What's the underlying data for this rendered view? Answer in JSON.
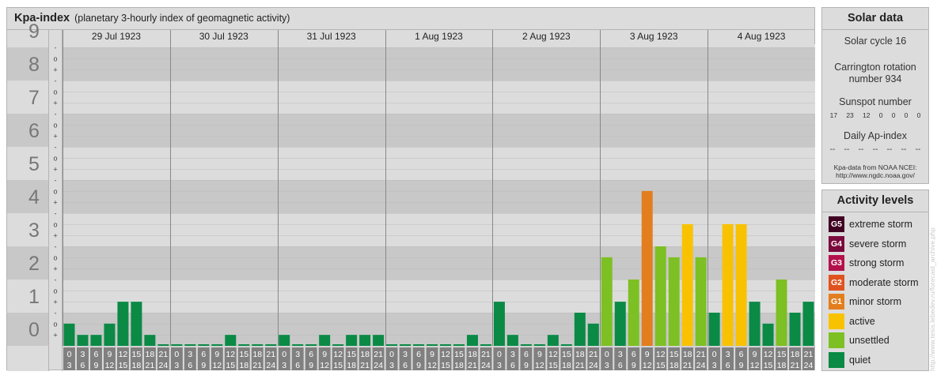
{
  "header": {
    "title": "Kpa-index",
    "subtitle": "(planetary 3-hourly index of geomagnetic activity)"
  },
  "chart_data": {
    "type": "bar",
    "ylim": [
      0,
      9
    ],
    "y_ticks": [
      "0",
      "1",
      "2",
      "3",
      "4",
      "5",
      "6",
      "7",
      "8",
      "9"
    ],
    "minor_tick_labels": [
      "+",
      "o",
      "-"
    ],
    "days": [
      "29 Jul 1923",
      "30 Jul 1923",
      "31 Jul 1923",
      "1 Aug 1923",
      "2 Aug 1923",
      "3 Aug 1923",
      "4 Aug 1923"
    ],
    "interval_starts": [
      "0",
      "3",
      "6",
      "9",
      "12",
      "15",
      "18",
      "21"
    ],
    "interval_ends": [
      "3",
      "6",
      "9",
      "12",
      "15",
      "18",
      "21",
      "24"
    ],
    "values": [
      0.67,
      0.33,
      0.33,
      0.67,
      1.33,
      1.33,
      0.33,
      0,
      0,
      0,
      0,
      0,
      0.33,
      0,
      0,
      0,
      0.33,
      0,
      0,
      0.33,
      0,
      0.33,
      0.33,
      0.33,
      0,
      0,
      0,
      0,
      0,
      0,
      0.33,
      0,
      1.33,
      0.33,
      0,
      0,
      0.33,
      0,
      1,
      0.67,
      2.67,
      1.33,
      2,
      4.67,
      3,
      2.67,
      3.67,
      2.67,
      1,
      3.67,
      3.67,
      1.33,
      0.67,
      2,
      1,
      1.33
    ],
    "colors": {
      "quiet": "#0a8a45",
      "unsettled": "#7dc023",
      "active": "#f9c200",
      "G1": "#e37e1e",
      "G2": "#e0531e",
      "G3": "#b3114c",
      "G4": "#7b0a3c",
      "G5": "#3f0022"
    },
    "grid": true
  },
  "solar": {
    "title": "Solar data",
    "cycle": "Solar cycle 16",
    "carrington_line1": "Carrington rotation",
    "carrington_line2": "number 934",
    "ssn_label": "Sunspot number",
    "ssn_values": [
      "17",
      "23",
      "12",
      "0",
      "0",
      "0",
      "0"
    ],
    "ap_label": "Daily Ap-index",
    "ap_values": [
      "--",
      "--",
      "--",
      "--",
      "--",
      "--",
      "--"
    ],
    "source_line1": "Kpa-data from NOAA NCEI:",
    "source_line2": "http://www.ngdc.noaa.gov/"
  },
  "activity": {
    "title": "Activity levels",
    "items": [
      {
        "code": "G5",
        "label": "extreme storm",
        "color": "#3f0022"
      },
      {
        "code": "G4",
        "label": "severe storm",
        "color": "#7b0a3c"
      },
      {
        "code": "G3",
        "label": "strong storm",
        "color": "#b3114c"
      },
      {
        "code": "G2",
        "label": "moderate storm",
        "color": "#e0531e"
      },
      {
        "code": "G1",
        "label": "minor storm",
        "color": "#e37e1e"
      },
      {
        "code": "",
        "label": "active",
        "color": "#f9c200"
      },
      {
        "code": "",
        "label": "unsettled",
        "color": "#7dc023"
      },
      {
        "code": "",
        "label": "quiet",
        "color": "#0a8a45"
      }
    ]
  },
  "watermark": "http://www.tesis.lebedev.ru/forecast_archive.php"
}
